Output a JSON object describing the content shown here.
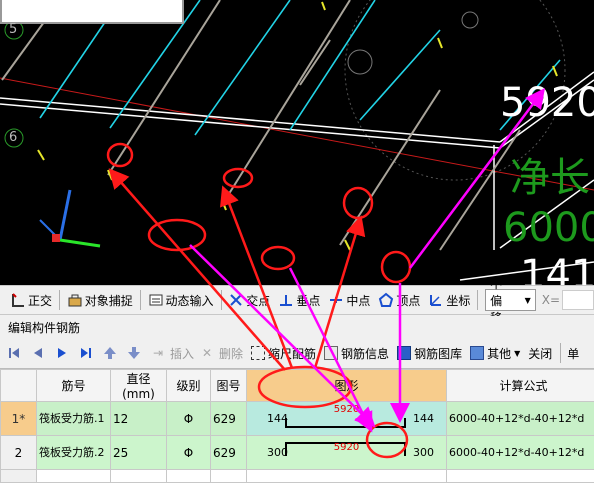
{
  "viewport": {
    "axis_labels": [
      "5",
      "6"
    ],
    "big_numbers": {
      "top": "5920",
      "green_text": "净长",
      "green_number": "6000",
      "bottom": "141"
    }
  },
  "snap_toolbar": {
    "buttons": [
      {
        "icon": "ortho-icon",
        "label": "正交"
      },
      {
        "icon": "object-snap-icon",
        "label": "对象捕捉"
      },
      {
        "icon": "dynamic-input-icon",
        "label": "动态输入"
      },
      {
        "icon": "intersection-icon",
        "label": "交点"
      },
      {
        "icon": "perpendicular-icon",
        "label": "垂点"
      },
      {
        "icon": "midpoint-icon",
        "label": "中点"
      },
      {
        "icon": "vertex-icon",
        "label": "顶点"
      },
      {
        "icon": "coordinate-icon",
        "label": "坐标"
      }
    ],
    "offset_select": "不偏移",
    "x_label": "X="
  },
  "panel": {
    "title": "编辑构件钢筋"
  },
  "edit_toolbar": {
    "insert": "插入",
    "delete": "删除",
    "scale_rebar": "缩尺配筋",
    "rebar_info": "钢筋信息",
    "rebar_library": "钢筋图库",
    "other": "其他",
    "close": "关闭",
    "single": "单"
  },
  "grid": {
    "columns": [
      "",
      "筋号",
      "直径(mm)",
      "级别",
      "图号",
      "图形",
      "计算公式"
    ],
    "rows": [
      {
        "num": "1*",
        "name": "筏板受力筋.1",
        "dia": "12",
        "grade": "Φ",
        "fig_no": "629",
        "left": "144",
        "mid": "5920",
        "right": "144",
        "formula": "6000-40+12*d-40+12*d"
      },
      {
        "num": "2",
        "name": "筏板受力筋.2",
        "dia": "25",
        "grade": "Φ",
        "fig_no": "629",
        "left": "300",
        "mid": "5920",
        "right": "300",
        "formula": "6000-40+12*d-40+12*d"
      }
    ]
  },
  "colors": {
    "cad_background": "#000000",
    "annotation_red": "#ff1a1a",
    "annotation_magenta": "#ff00ff",
    "selected_header": "#f7cc8c",
    "row_green": "#c8f0c8"
  }
}
